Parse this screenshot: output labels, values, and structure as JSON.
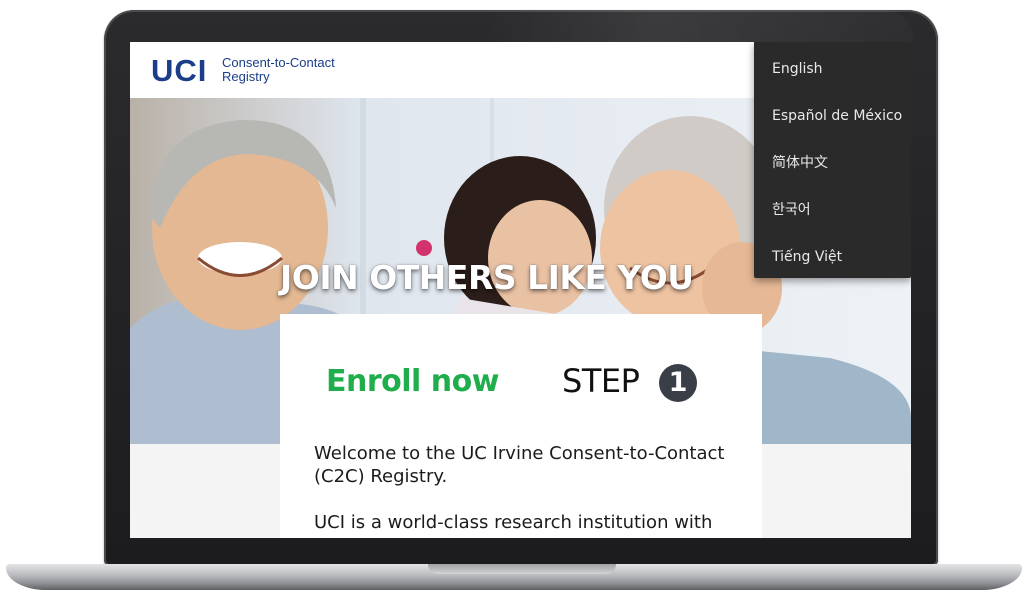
{
  "logo": {
    "mark": "UCI",
    "line1": "Consent-to-Contact",
    "line2": "Registry"
  },
  "hero": {
    "title": "JOIN OTHERS LIKE YOU"
  },
  "language_menu": {
    "items": [
      {
        "label": "English"
      },
      {
        "label": "Español de México"
      },
      {
        "label": "简体中文"
      },
      {
        "label": "한국어"
      },
      {
        "label": "Tiếng Việt"
      }
    ]
  },
  "card": {
    "enroll_label": "Enroll now",
    "step_label": "STEP",
    "step_number": "1",
    "paragraphs": [
      "Welcome to the UC Irvine Consent-to-Contact (C2C) Registry.",
      "UCI is a world-class research institution with"
    ]
  },
  "colors": {
    "brand_blue": "#1b3d8a",
    "enroll_green": "#1fae4b",
    "menu_bg": "#2a2a2a"
  }
}
